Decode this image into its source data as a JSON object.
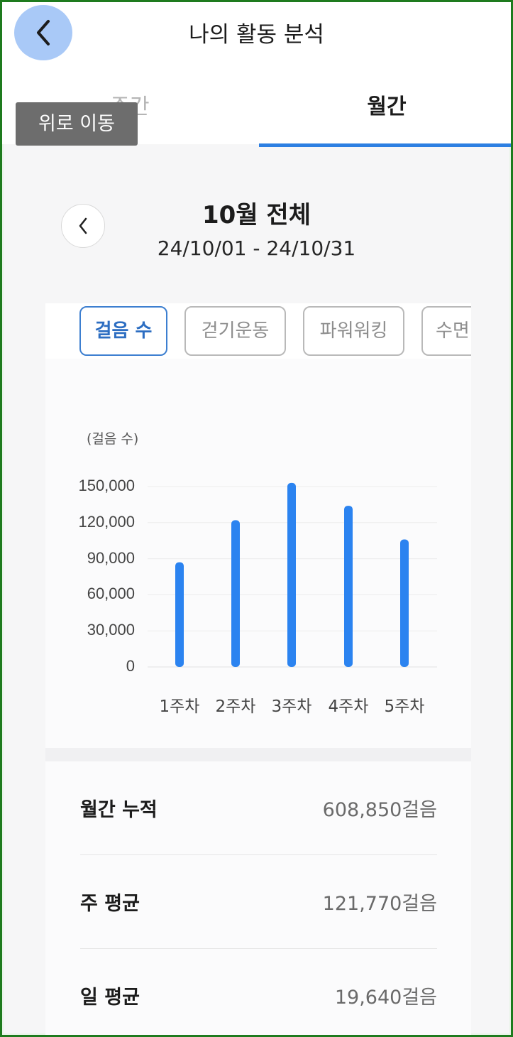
{
  "header": {
    "title": "나의 활동 분석",
    "back_icon": "chevron-left-icon"
  },
  "tabs": [
    {
      "label": "주간",
      "selected": false
    },
    {
      "label": "월간",
      "selected": true
    }
  ],
  "tooltip": {
    "text": "위로 이동"
  },
  "period": {
    "title": "10월 전체",
    "range": "24/10/01 - 24/10/31",
    "prev_icon": "chevron-left-icon"
  },
  "chips": [
    {
      "label": "걸음 수",
      "active": true
    },
    {
      "label": "걷기운동",
      "active": false
    },
    {
      "label": "파워워킹",
      "active": false
    },
    {
      "label": "수면",
      "active": false
    }
  ],
  "colors": {
    "accent": "#2d7fe2",
    "bar": "#2b83f0",
    "tooltip_bg": "#6d6d6d",
    "back_button_bg": "#a9c9f7"
  },
  "chart_data": {
    "type": "bar",
    "ylabel": "(걸음 수)",
    "categories": [
      "1주차",
      "2주차",
      "3주차",
      "4주차",
      "5주차"
    ],
    "values": [
      87000,
      122000,
      153000,
      134000,
      106000
    ],
    "yticks": [
      "0",
      "30,000",
      "60,000",
      "90,000",
      "120,000",
      "150,000"
    ],
    "ylim": [
      0,
      150000
    ],
    "grid": true
  },
  "stats": [
    {
      "label": "월간 누적",
      "value": "608,850걸음"
    },
    {
      "label": "주 평균",
      "value": "121,770걸음"
    },
    {
      "label": "일 평균",
      "value": "19,640걸음"
    }
  ]
}
